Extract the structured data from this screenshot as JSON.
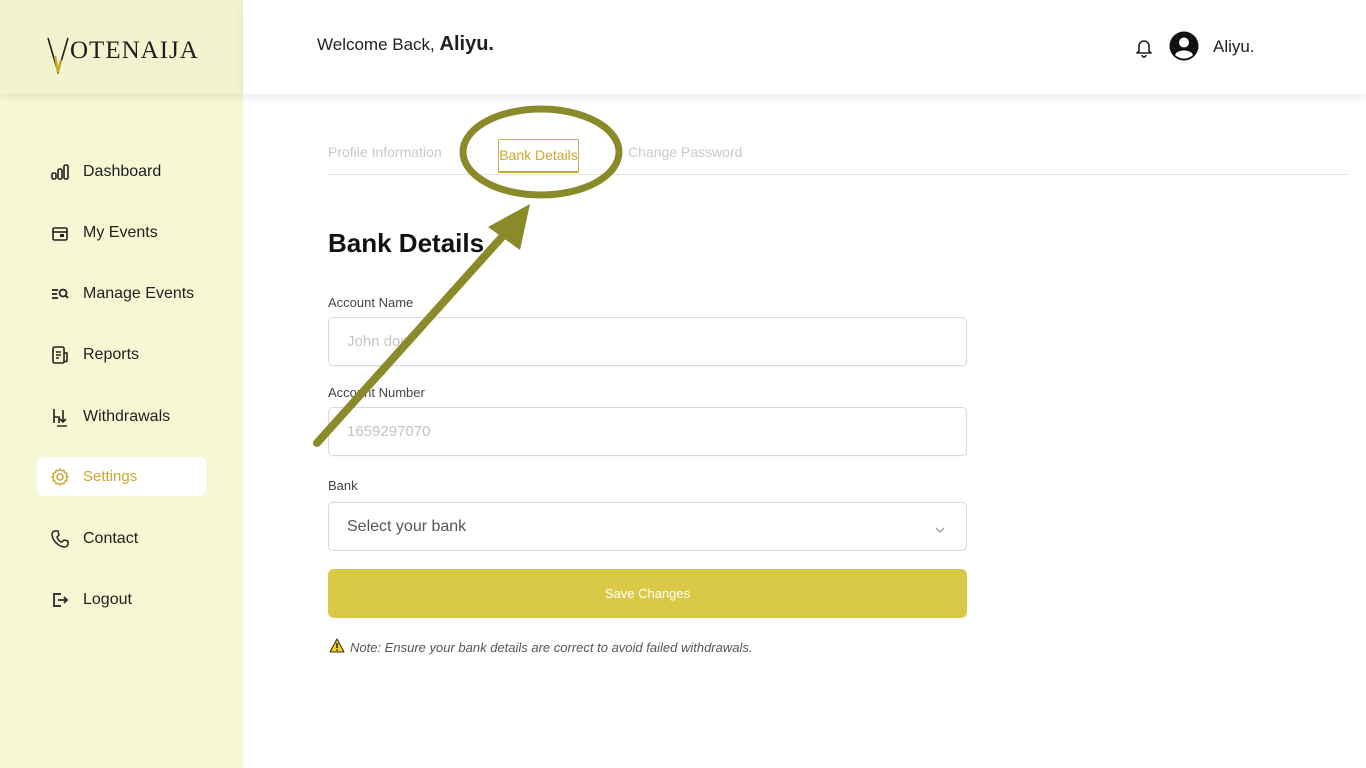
{
  "brand": {
    "logo_letter": "V",
    "logo_text": "OTENAIJA"
  },
  "header": {
    "welcome_text": "Welcome Back,",
    "welcome_name": "Aliyu.",
    "user_name": "Aliyu."
  },
  "sidebar": {
    "items": [
      {
        "label": "Dashboard",
        "icon": "bar-chart-icon"
      },
      {
        "label": "My Events",
        "icon": "calendar-icon"
      },
      {
        "label": "Manage Events",
        "icon": "list-search-icon"
      },
      {
        "label": "Reports",
        "icon": "report-icon"
      },
      {
        "label": "Withdrawals",
        "icon": "withdraw-icon"
      },
      {
        "label": "Settings",
        "icon": "gear-icon",
        "active": true
      },
      {
        "label": "Contact",
        "icon": "phone-icon"
      },
      {
        "label": "Logout",
        "icon": "logout-icon"
      }
    ]
  },
  "tabs": [
    {
      "label": "Profile Information"
    },
    {
      "label": "Bank Details",
      "active": true
    },
    {
      "label": "Change Password"
    }
  ],
  "form": {
    "title": "Bank Details",
    "account_name": {
      "label": "Account Name",
      "placeholder": "John doe"
    },
    "account_number": {
      "label": "Account Number",
      "placeholder": "1659297070"
    },
    "bank": {
      "label": "Bank",
      "value": "Select your bank"
    },
    "save_label": "Save Changes",
    "note": "Note: Ensure your bank details are correct to avoid failed withdrawals."
  },
  "colors": {
    "accent": "#c9a92b",
    "button": "#dac946",
    "sidebar_bg": "#f6f7d3",
    "annotation": "#8b8a2b"
  }
}
